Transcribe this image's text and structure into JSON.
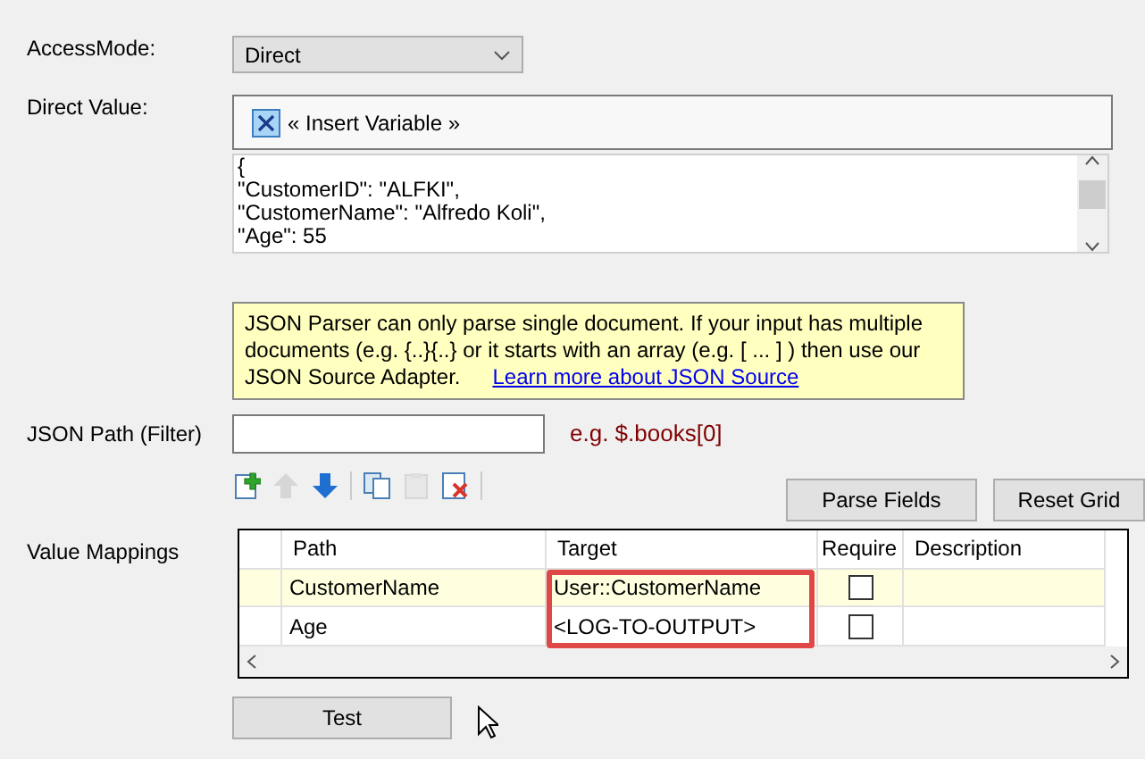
{
  "access_mode": {
    "label": "AccessMode:",
    "value": "Direct"
  },
  "direct_value": {
    "label": "Direct Value:",
    "insert_variable": "« Insert Variable »",
    "lines": [
      "{",
      "\"CustomerID\": \"ALFKI\",",
      "\"CustomerName\": \"Alfredo Koli\",",
      "\"Age\": 55"
    ]
  },
  "info": {
    "text": "JSON Parser can only parse single document. If your input has multiple documents (e.g. {..}{..} or it starts with an array (e.g. [ ... ] ) then use our JSON Source Adapter.",
    "link": "Learn more about JSON Source"
  },
  "json_path": {
    "label": "JSON Path (Filter)",
    "hint": "e.g. $.books[0]"
  },
  "toolbar": [
    {
      "kind": "add",
      "disabled": false
    },
    {
      "kind": "up",
      "disabled": true
    },
    {
      "kind": "down",
      "disabled": false
    },
    {
      "kind": "copy",
      "disabled": false
    },
    {
      "kind": "paste",
      "disabled": true
    },
    {
      "kind": "delete",
      "disabled": false
    }
  ],
  "parse_button": "Parse Fields",
  "reset_button": "Reset Grid",
  "mappings": {
    "label": "Value Mappings",
    "columns": [
      "Path",
      "Target",
      "Require",
      "Description"
    ],
    "rows": [
      {
        "path": "CustomerName",
        "target": "User::CustomerName",
        "required": false,
        "selected": true
      },
      {
        "path": "Age",
        "target": "<LOG-TO-OUTPUT>",
        "required": false,
        "selected": false
      }
    ]
  },
  "test_button": "Test"
}
